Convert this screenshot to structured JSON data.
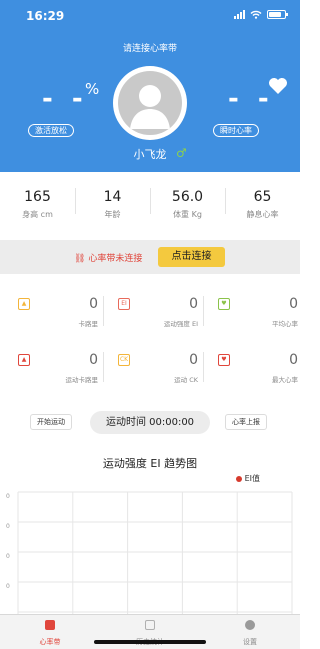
{
  "status_bar": {
    "time": "16:29"
  },
  "header": {
    "connect_prompt": "请连接心率带",
    "left_value": "- -",
    "left_unit": "%",
    "left_label": "激活放松",
    "right_value": "- -",
    "right_label": "瞬时心率",
    "username": "小飞龙",
    "gender_symbol": "♂"
  },
  "stats": [
    {
      "value": "165",
      "label": "身高 cm"
    },
    {
      "value": "14",
      "label": "年龄"
    },
    {
      "value": "56.0",
      "label": "体重 Kg"
    },
    {
      "value": "65",
      "label": "静息心率"
    }
  ],
  "connection": {
    "status": "心率带未连接",
    "button": "点击连接"
  },
  "metrics": [
    {
      "icon": "flame-icon",
      "icon_text": "🔥",
      "value": "0",
      "label": "卡路里",
      "color": "#f3b53a"
    },
    {
      "icon": "ei-icon",
      "icon_text": "EI",
      "value": "0",
      "label": "运动强度 EI",
      "color": "#e86a5a"
    },
    {
      "icon": "heart-rate-avg-icon",
      "icon_text": "♥",
      "value": "0",
      "label": "平均心率",
      "color": "#8bc34a"
    },
    {
      "icon": "sport-calorie-icon",
      "icon_text": "🔥",
      "value": "0",
      "label": "运动卡路里",
      "color": "#e0463c"
    },
    {
      "icon": "ck-icon",
      "icon_text": "CK",
      "value": "0",
      "label": "运动 CK",
      "color": "#f3b53a"
    },
    {
      "icon": "heart-rate-max-icon",
      "icon_text": "♥",
      "value": "0",
      "label": "最大心率",
      "color": "#e0463c"
    }
  ],
  "controls": {
    "start_button": "开始运动",
    "sport_time": "运动时间 00:00:00",
    "report_button": "心率上报"
  },
  "chart_data": {
    "type": "line",
    "title": "运动强度 EI 趋势图",
    "series": [
      {
        "name": "EI值",
        "values": []
      }
    ],
    "y_tick_labels": [
      "0",
      "0",
      "0",
      "0"
    ],
    "grid": true,
    "legend": "top-right",
    "series_color": "#d63a2d"
  },
  "tabbar": {
    "items": [
      {
        "label": "心率带",
        "active": true
      },
      {
        "label": "历史统计",
        "active": false
      },
      {
        "label": "设置",
        "active": false
      }
    ]
  }
}
